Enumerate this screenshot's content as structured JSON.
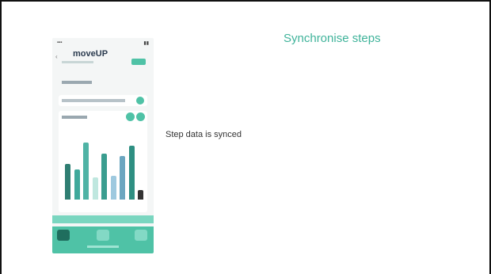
{
  "slide": {
    "title": "Synchronise steps",
    "caption": "Step data is synced"
  },
  "phone": {
    "logo_part1": "move",
    "logo_part2": "UP",
    "icons": {
      "back": "chevron-left-icon",
      "tab1": "steps-tab-icon",
      "tab2": "profile-tab-icon",
      "tab3": "settings-tab-icon"
    },
    "chart_data": {
      "type": "bar",
      "values": [
        0.45,
        0.38,
        0.72,
        0.28,
        0.58,
        0.3,
        0.55,
        0.68,
        0.12
      ],
      "colors": [
        "#2f7e72",
        "#3fa99b",
        "#4fb3a5",
        "#bfe7df",
        "#3a9d8f",
        "#9ec9df",
        "#6ba6c0",
        "#2e8f82",
        "#333333"
      ]
    },
    "colors": {
      "accent": "#4fc2a6",
      "tab_active": "#1f6e5e",
      "title": "#3fb39a"
    }
  }
}
